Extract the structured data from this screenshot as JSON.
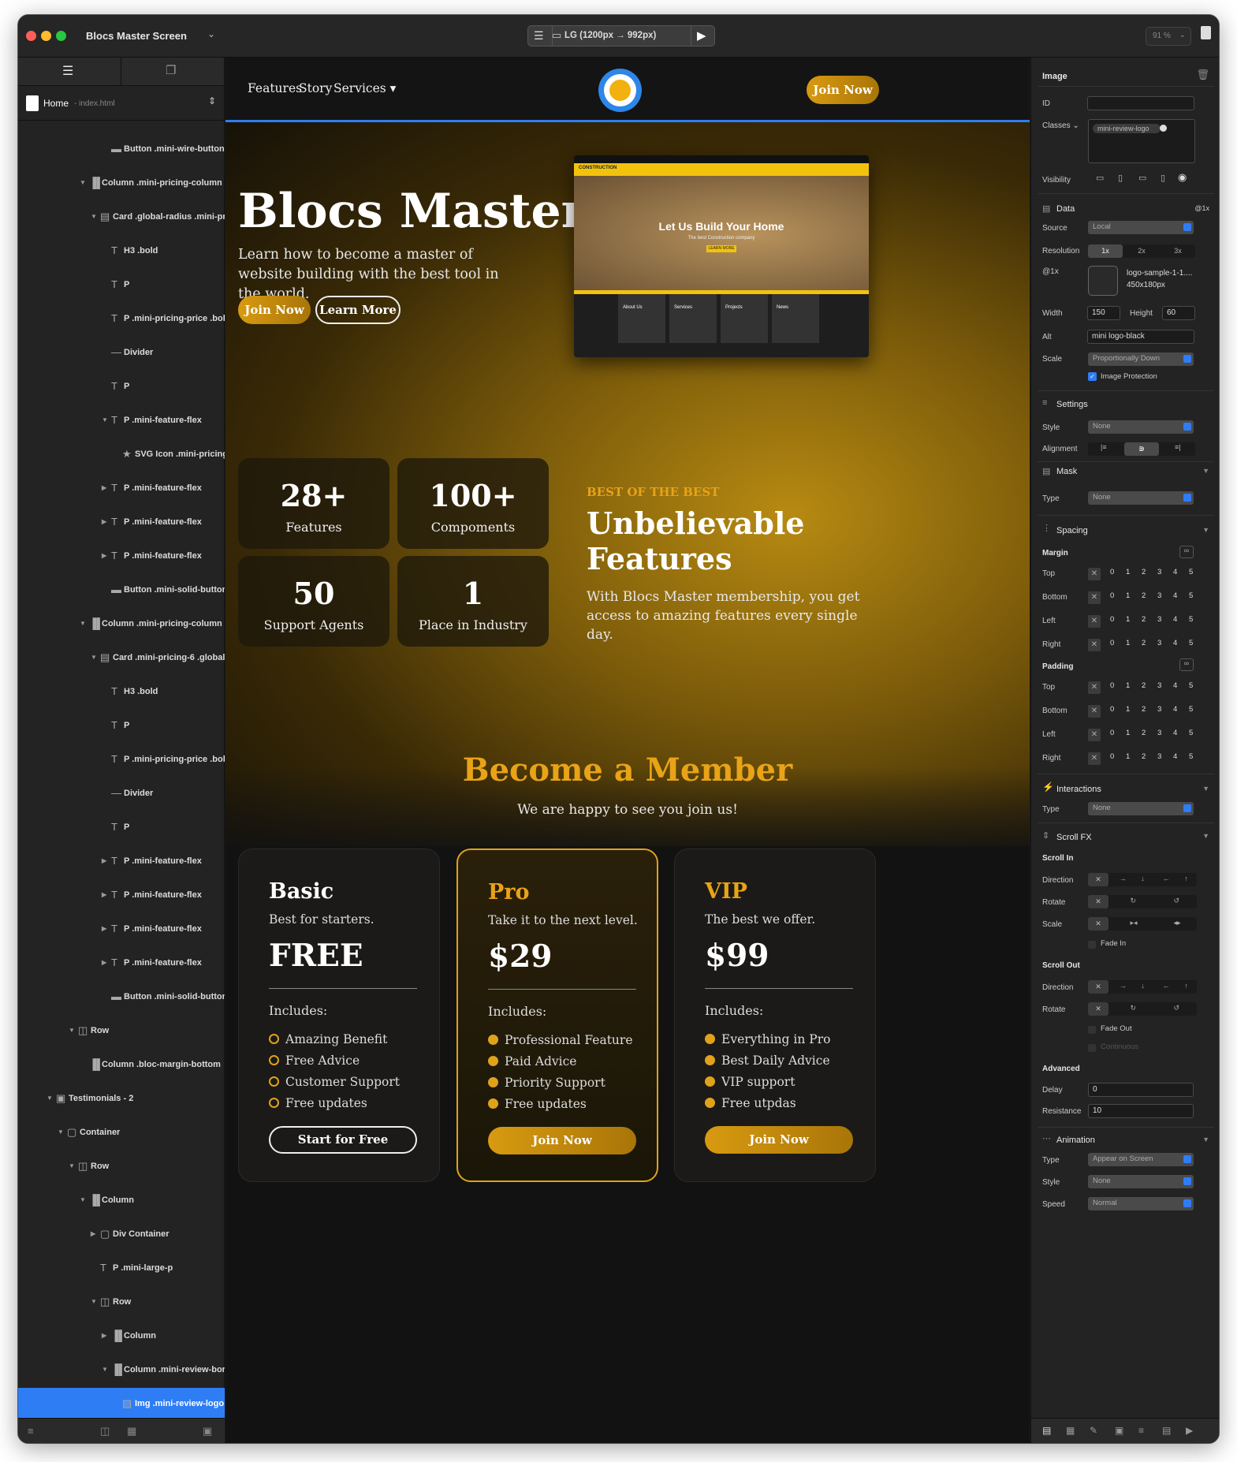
{
  "window": {
    "title": "Blocs Master Screen",
    "device": "LG (1200px → 992px)",
    "zoom": "91 %"
  },
  "left_panel": {
    "page_name": "Home",
    "page_file": "- index.html",
    "tree": [
      {
        "label": "Button .mini-wire-button",
        "indent": 4,
        "arrow": "",
        "icon": "▬"
      },
      {
        "label": "Column .mini-pricing-column",
        "indent": 2,
        "arrow": "▼",
        "icon": "▐▌"
      },
      {
        "label": "Card .global-radius .mini-pri",
        "indent": 3,
        "arrow": "▼",
        "icon": "▤"
      },
      {
        "label": "H3 .bold",
        "indent": 4,
        "arrow": "",
        "icon": "T"
      },
      {
        "label": "P",
        "indent": 4,
        "arrow": "",
        "icon": "T"
      },
      {
        "label": "P .mini-pricing-price .bolc",
        "indent": 4,
        "arrow": "",
        "icon": "T"
      },
      {
        "label": "Divider",
        "indent": 4,
        "arrow": "",
        "icon": "—"
      },
      {
        "label": "P",
        "indent": 4,
        "arrow": "",
        "icon": "T"
      },
      {
        "label": "P .mini-feature-flex",
        "indent": 4,
        "arrow": "▼",
        "icon": "T"
      },
      {
        "label": "SVG Icon .mini-pricing",
        "indent": 5,
        "arrow": "",
        "icon": "★"
      },
      {
        "label": "P .mini-feature-flex",
        "indent": 4,
        "arrow": "▶",
        "icon": "T"
      },
      {
        "label": "P .mini-feature-flex",
        "indent": 4,
        "arrow": "▶",
        "icon": "T"
      },
      {
        "label": "P .mini-feature-flex",
        "indent": 4,
        "arrow": "▶",
        "icon": "T"
      },
      {
        "label": "Button .mini-solid-button",
        "indent": 4,
        "arrow": "",
        "icon": "▬"
      },
      {
        "label": "Column .mini-pricing-column",
        "indent": 2,
        "arrow": "▼",
        "icon": "▐▌"
      },
      {
        "label": "Card .mini-pricing-6 .global-",
        "indent": 3,
        "arrow": "▼",
        "icon": "▤"
      },
      {
        "label": "H3 .bold",
        "indent": 4,
        "arrow": "",
        "icon": "T"
      },
      {
        "label": "P",
        "indent": 4,
        "arrow": "",
        "icon": "T"
      },
      {
        "label": "P .mini-pricing-price .bolc",
        "indent": 4,
        "arrow": "",
        "icon": "T"
      },
      {
        "label": "Divider",
        "indent": 4,
        "arrow": "",
        "icon": "—"
      },
      {
        "label": "P",
        "indent": 4,
        "arrow": "",
        "icon": "T"
      },
      {
        "label": "P .mini-feature-flex",
        "indent": 4,
        "arrow": "▶",
        "icon": "T"
      },
      {
        "label": "P .mini-feature-flex",
        "indent": 4,
        "arrow": "▶",
        "icon": "T"
      },
      {
        "label": "P .mini-feature-flex",
        "indent": 4,
        "arrow": "▶",
        "icon": "T"
      },
      {
        "label": "P .mini-feature-flex",
        "indent": 4,
        "arrow": "▶",
        "icon": "T"
      },
      {
        "label": "Button .mini-solid-button",
        "indent": 4,
        "arrow": "",
        "icon": "▬"
      },
      {
        "label": "Row",
        "indent": 1,
        "arrow": "▼",
        "icon": "◫"
      },
      {
        "label": "Column .bloc-margin-bottom",
        "indent": 2,
        "arrow": "",
        "icon": "▐▌"
      },
      {
        "label": "Testimonials - 2",
        "indent": -1,
        "arrow": "▼",
        "icon": "▣"
      },
      {
        "label": "Container",
        "indent": 0,
        "arrow": "▼",
        "icon": "▢"
      },
      {
        "label": "Row",
        "indent": 1,
        "arrow": "▼",
        "icon": "◫"
      },
      {
        "label": "Column",
        "indent": 2,
        "arrow": "▼",
        "icon": "▐▌"
      },
      {
        "label": "Div Container",
        "indent": 3,
        "arrow": "▶",
        "icon": "▢"
      },
      {
        "label": "P .mini-large-p",
        "indent": 3,
        "arrow": "",
        "icon": "T"
      },
      {
        "label": "Row",
        "indent": 3,
        "arrow": "▼",
        "icon": "◫"
      },
      {
        "label": "Column",
        "indent": 4,
        "arrow": "▶",
        "icon": "▐▌"
      },
      {
        "label": "Column .mini-review-borc",
        "indent": 4,
        "arrow": "▼",
        "icon": "▐▌"
      },
      {
        "label": "Img .mini-review-logo",
        "indent": 5,
        "arrow": "",
        "icon": "▨",
        "selected": true
      }
    ]
  },
  "site": {
    "nav": {
      "links": [
        "Features",
        "Story",
        "Services ▾"
      ],
      "cta": "Join Now"
    },
    "hero": {
      "title": "Blocs Master",
      "subtitle": "Learn how to become a master of website building with the best tool in the world.",
      "btn_primary": "Join Now",
      "btn_secondary": "Learn More"
    },
    "mockup": {
      "brand": "CONSTRUCTION",
      "headline": "Let Us Build Your Home",
      "sub": "The best Construction company",
      "btn": "LEARN MORE",
      "cards": [
        "About Us",
        "Services",
        "Projects",
        "News"
      ]
    },
    "stats": [
      {
        "num": "28+",
        "label": "Features"
      },
      {
        "num": "100+",
        "label": "Compoments"
      },
      {
        "num": "50",
        "label": "Support Agents"
      },
      {
        "num": "1",
        "label": "Place in Industry"
      }
    ],
    "features": {
      "eyebrow": "BEST OF THE BEST",
      "title": "Unbelievable Features",
      "text": "With Blocs Master membership, you get access to amazing features every single day."
    },
    "member": {
      "title": "Become a Member",
      "subtitle": "We are happy to see you join us!"
    },
    "plans": [
      {
        "name": "Basic",
        "desc": "Best for starters.",
        "price": "FREE",
        "includes": "Includes:",
        "features": [
          "Amazing Benefit",
          "Free Advice",
          "Customer Support",
          "Free updates"
        ],
        "button": "Start for Free"
      },
      {
        "name": "Pro",
        "desc": "Take it to the next level.",
        "price": "$29",
        "includes": "Includes:",
        "features": [
          "Professional Feature",
          "Paid Advice",
          "Priority Support",
          "Free updates"
        ],
        "button": "Join Now"
      },
      {
        "name": "VIP",
        "desc": "The best we offer.",
        "price": "$99",
        "includes": "Includes:",
        "features": [
          "Everything in Pro",
          "Best Daily Advice",
          "VIP support",
          "Free utpdas"
        ],
        "button": "Join Now"
      }
    ]
  },
  "inspector": {
    "header": "Image",
    "id_label": "ID",
    "classes_label": "Classes ⌄",
    "class_tag": "mini-review-logo",
    "visibility_label": "Visibility",
    "data": {
      "title": "Data",
      "retina": "@1x",
      "source_label": "Source",
      "source": "Local",
      "resolution_label": "Resolution",
      "res_options": [
        "1x",
        "2x",
        "3x"
      ],
      "at1x": "@1x",
      "file_name": "logo-sample-1-1....",
      "file_size": "450x180px",
      "width_label": "Width",
      "width": "150",
      "height_label": "Height",
      "height": "60",
      "alt_label": "Alt",
      "alt": "mini logo-black",
      "scale_label": "Scale",
      "scale": "Proportionally Down",
      "protection": "Image Protection"
    },
    "settings": {
      "title": "Settings",
      "style_label": "Style",
      "style": "None",
      "alignment_label": "Alignment"
    },
    "mask": {
      "title": "Mask",
      "type_label": "Type",
      "type": "None"
    },
    "spacing": {
      "title": "Spacing",
      "margin": "Margin",
      "padding": "Padding",
      "sides": [
        "Top",
        "Bottom",
        "Left",
        "Right"
      ],
      "steps": [
        "0",
        "1",
        "2",
        "3",
        "4",
        "5"
      ]
    },
    "interactions": {
      "title": "Interactions",
      "type_label": "Type",
      "type": "None"
    },
    "scrollfx": {
      "title": "Scroll FX",
      "scroll_in": "Scroll In",
      "direction": "Direction",
      "rotate": "Rotate",
      "scale": "Scale",
      "fade_in": "Fade In",
      "scroll_out": "Scroll Out",
      "fade_out": "Fade Out",
      "continuous": "Continuous",
      "advanced": "Advanced",
      "delay_label": "Delay",
      "delay": "0",
      "resistance_label": "Resistance",
      "resistance": "10"
    },
    "animation": {
      "title": "Animation",
      "type_label": "Type",
      "type": "Appear on Screen",
      "style_label": "Style",
      "style": "None",
      "speed_label": "Speed",
      "speed": "Normal"
    }
  }
}
